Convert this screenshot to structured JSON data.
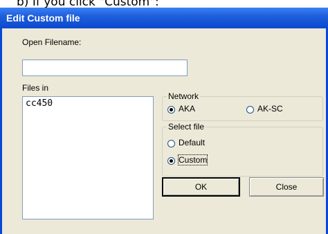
{
  "caption": "b) If you click \"Custom\":",
  "window": {
    "title": "Edit Custom file"
  },
  "open_filename": {
    "label": "Open Filename:",
    "value": ""
  },
  "files_in": {
    "label": "Files in",
    "items": [
      "cc450"
    ]
  },
  "network": {
    "legend": "Network",
    "options": [
      {
        "label": "AKA",
        "selected": true
      },
      {
        "label": "AK-SC",
        "selected": false
      }
    ]
  },
  "select_file": {
    "legend": "Select file",
    "options": [
      {
        "label": "Default",
        "selected": false
      },
      {
        "label": "Custom",
        "selected": true
      }
    ]
  },
  "buttons": {
    "ok": "OK",
    "close": "Close"
  }
}
